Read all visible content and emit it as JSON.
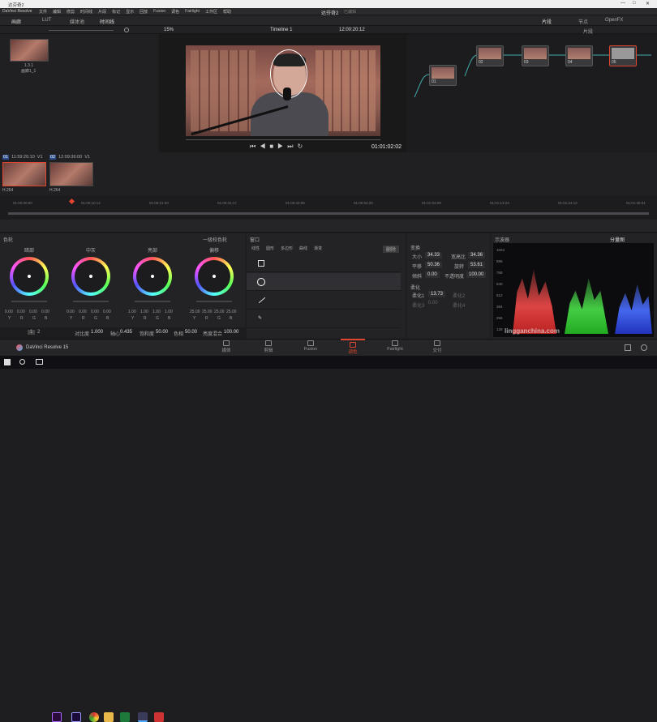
{
  "window": {
    "title": "DaVinci Resolve",
    "menus": [
      "文件",
      "编辑",
      "修剪",
      "时间线",
      "片段",
      "标记",
      "显示",
      "回放",
      "Fusion",
      "调色",
      "Fairlight",
      "工作区",
      "帮助"
    ],
    "project_name": "达芬奇2",
    "edited": "已编辑"
  },
  "toolbar": {
    "gallery": "画廊",
    "lut": "LUT",
    "media_pool": "媒体池",
    "timeline_btn": "时间线",
    "zoom": "15%",
    "timeline_name": "Timeline 1",
    "timecode": "12:00:20:12",
    "clip_mode": "片段",
    "nodes": "节点",
    "openfx": "OpenFX"
  },
  "gallery": {
    "still_label": "1.3.1",
    "still_sub": "画廊1_1"
  },
  "viewer": {
    "timecode": "01:01:02:02"
  },
  "nodes": [
    {
      "label": "01"
    },
    {
      "label": "02"
    },
    {
      "label": "03"
    },
    {
      "label": "04"
    },
    {
      "label": "05"
    }
  ],
  "clips": [
    {
      "index": "01",
      "tc": "11:59:26:10",
      "track": "V1",
      "codec": "H.264"
    },
    {
      "index": "02",
      "tc": "12:09:36:00",
      "track": "V1",
      "codec": "H.264"
    }
  ],
  "ruler": [
    "01:00:00:00",
    "01:00:10:14",
    "01:00:21:03",
    "01:00:31:17",
    "01:00:42:06",
    "01:00:52:20",
    "01:01:03:09",
    "01:01:13:23",
    "01:01:24:12",
    "01:01:35:01"
  ],
  "color_wheels": {
    "panel_title": "色轮",
    "mode": "一级校色轮",
    "wheels": [
      {
        "name": "暗部",
        "vals": [
          "0.00",
          "0.00",
          "0.00",
          "0.00"
        ]
      },
      {
        "name": "中灰",
        "vals": [
          "0.00",
          "0.00",
          "0.00",
          "0.00"
        ]
      },
      {
        "name": "亮部",
        "vals": [
          "1.00",
          "1.00",
          "1.00",
          "1.00"
        ]
      },
      {
        "name": "偏移",
        "vals": [
          "25.00",
          "25.00",
          "25.00",
          "25.00"
        ]
      }
    ],
    "chan": [
      "Y",
      "R",
      "G",
      "B"
    ],
    "bottom": {
      "page1": "1",
      "page2": "2",
      "contrast_l": "对比度",
      "contrast_v": "1.000",
      "pivot_l": "轴心",
      "pivot_v": "0.435",
      "sat_l": "饱和度",
      "sat_v": "50.00",
      "hue_l": "色相",
      "hue_v": "50.00",
      "lum_l": "亮度混合",
      "lum_v": "100.00"
    }
  },
  "window_panel": {
    "title": "窗口",
    "tools": [
      "线性",
      "圆形",
      "多边形",
      "曲线",
      "渐变"
    ],
    "reset": "删除"
  },
  "transform": {
    "title": "变换",
    "size_l": "大小",
    "size_v": "34.33",
    "aspect_l": "宽高比",
    "aspect_v": "34.36",
    "pan_l": "平移",
    "pan_v": "50.36",
    "rotate_l": "旋转",
    "rotate_v": "53.61",
    "tilt_l": "倾斜",
    "tilt_v": "0.00",
    "opacity_l": "不透明度",
    "opacity_v": "100.00",
    "soft_title": "柔化",
    "soft1_l": "柔化1",
    "soft1_v": "13.73",
    "soft3_l": "柔化3",
    "soft3_v": "0.00",
    "soft2_l": "柔化2",
    "soft4_l": "柔化4"
  },
  "scope": {
    "title": "示波器",
    "mode": "分量图",
    "ticks": [
      "1023",
      "896",
      "768",
      "640",
      "512",
      "384",
      "256",
      "128"
    ]
  },
  "pages": [
    {
      "label": "媒体"
    },
    {
      "label": "剪辑"
    },
    {
      "label": "Fusion"
    },
    {
      "label": "调色"
    },
    {
      "label": "Fairlight"
    },
    {
      "label": "交付"
    }
  ],
  "app": {
    "name": "DaVinci Resolve 15"
  },
  "watermark": {
    "text": "lingganchina.com"
  },
  "colors": {
    "accent": "#e0452f",
    "panel": "#232325"
  }
}
